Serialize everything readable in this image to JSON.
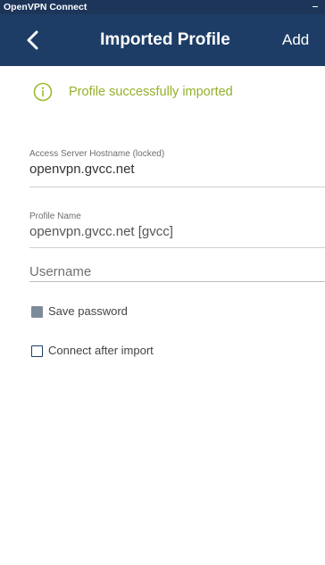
{
  "window": {
    "title": "OpenVPN Connect",
    "minimize_symbol": "–"
  },
  "header": {
    "back_icon": "chevron-left-icon",
    "title": "Imported Profile",
    "add_label": "Add"
  },
  "status": {
    "icon": "info-circle-icon",
    "message": "Profile successfully imported"
  },
  "fields": {
    "hostname": {
      "label": "Access Server Hostname (locked)",
      "value": "openvpn.gvcc.net"
    },
    "profile_name": {
      "label": "Profile Name",
      "value": "openvpn.gvcc.net [gvcc]"
    },
    "username": {
      "placeholder": "Username",
      "value": ""
    }
  },
  "options": {
    "save_password": {
      "label": "Save password",
      "checked": false,
      "disabled": true
    },
    "connect_after_import": {
      "label": "Connect after import",
      "checked": false,
      "disabled": false
    }
  },
  "colors": {
    "titlebar": "#1c3559",
    "header": "#1d3d66",
    "success": "#92b12a",
    "info_icon": "#9aba2e"
  }
}
